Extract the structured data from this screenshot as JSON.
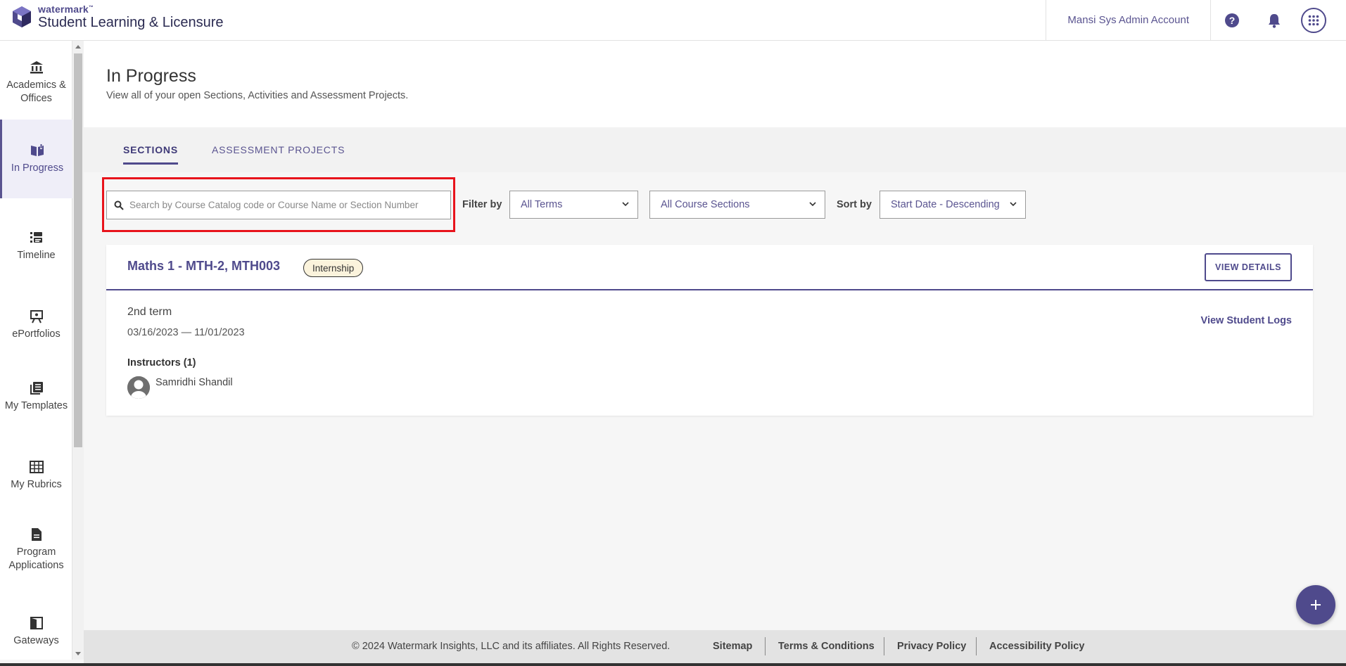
{
  "header": {
    "brand_small": "watermark",
    "brand_tm": "™",
    "brand_main": "Student Learning & Licensure",
    "account": "Mansi Sys Admin Account"
  },
  "sidebar": {
    "items": [
      {
        "label": "Academics & Offices",
        "icon": "institution-icon"
      },
      {
        "label": "In Progress",
        "icon": "book-open-icon"
      },
      {
        "label": "Timeline",
        "icon": "timeline-icon"
      },
      {
        "label": "ePortfolios",
        "icon": "presentation-icon"
      },
      {
        "label": "My Templates",
        "icon": "templates-icon"
      },
      {
        "label": "My Rubrics",
        "icon": "grid-icon"
      },
      {
        "label": "Program Applications",
        "icon": "document-icon"
      },
      {
        "label": "Gateways",
        "icon": "gateway-icon"
      }
    ]
  },
  "page": {
    "title": "In Progress",
    "subtitle": "View all of your open Sections, Activities and Assessment Projects."
  },
  "tabs": [
    {
      "label": "SECTIONS",
      "active": true
    },
    {
      "label": "ASSESSMENT PROJECTS",
      "active": false
    }
  ],
  "filters": {
    "search_placeholder": "Search by Course Catalog code or Course Name or Section Number",
    "filter_label": "Filter by",
    "term_value": "All Terms",
    "sections_value": "All Course Sections",
    "sort_label": "Sort by",
    "sort_value": "Start Date - Descending"
  },
  "card": {
    "title": "Maths 1 - MTH-2, MTH003",
    "badge": "Internship",
    "view_details": "VIEW DETAILS",
    "term": "2nd term",
    "dates": "03/16/2023 — 11/01/2023",
    "instructors_label": "Instructors (1)",
    "instructor_name": "Samridhi Shandil",
    "logs_link": "View Student Logs"
  },
  "footer": {
    "copyright": "© 2024 Watermark Insights, LLC and its affiliates. All Rights Reserved.",
    "links": [
      "Sitemap",
      "Terms & Conditions",
      "Privacy Policy",
      "Accessibility Policy"
    ]
  },
  "colors": {
    "accent": "#4f4a8c",
    "highlight": "#e8141c",
    "badge_bg": "#fbf3dc"
  }
}
